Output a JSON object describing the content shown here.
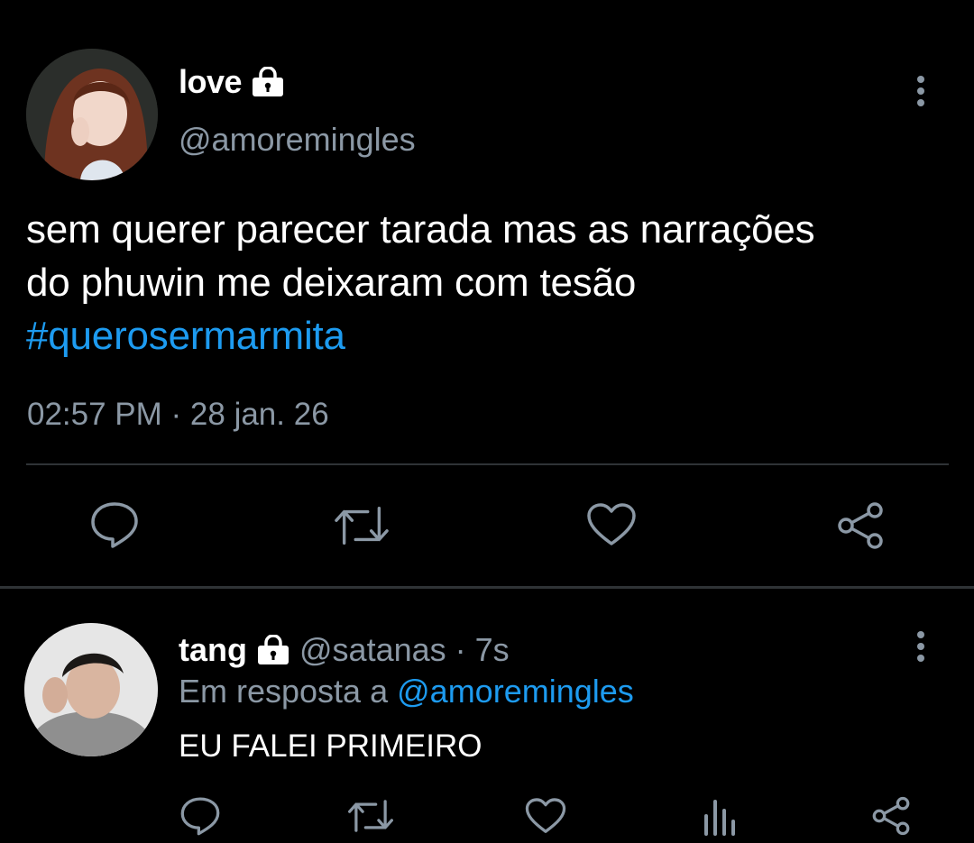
{
  "main_tweet": {
    "display_name": "love",
    "handle": "@amoremingles",
    "text_lines": [
      "sem querer parecer tarada mas as narrações",
      "do phuwin me deixaram com tesão"
    ],
    "hashtag": "#querosermarmita",
    "timestamp": "02:57 PM · 28 jan. 26",
    "actions": [
      "reply-icon",
      "retweet-icon",
      "like-icon",
      "share-icon"
    ]
  },
  "reply_tweet": {
    "display_name": "tang",
    "handle": "@satanas",
    "time_separator": "·",
    "time": "7s",
    "reply_prefix": "Em resposta a",
    "reply_mention": "@amoremingles",
    "text": "EU FALEI PRIMEIRO",
    "actions": [
      "reply-icon",
      "retweet-icon",
      "like-icon",
      "analytics-icon",
      "share-icon"
    ]
  },
  "colors": {
    "background": "#000000",
    "text_primary": "#ffffff",
    "text_secondary": "#8b98a5",
    "accent": "#1d9bf0",
    "divider": "#2f3336"
  }
}
